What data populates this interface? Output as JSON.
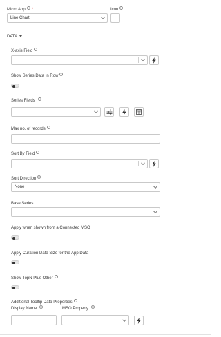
{
  "micro_app": {
    "label": "Micro App",
    "value": "Line Chart"
  },
  "icon": {
    "label": "Icon"
  },
  "data_section": {
    "label": "DATA"
  },
  "x_axis_field": {
    "label": "X-axis Field"
  },
  "show_series_data_in_row": {
    "label": "Show Series Data In Row"
  },
  "series_fields": {
    "label": "Series Fields"
  },
  "max_records": {
    "label": "Max no. of records",
    "value": ""
  },
  "sort_by_field": {
    "label": "Sort By Field"
  },
  "sort_direction": {
    "label": "Sort Direction",
    "value": "None"
  },
  "base_series": {
    "label": "Base Series"
  },
  "apply_connected_mso": {
    "label": "Apply when shown from a Connected MSO"
  },
  "apply_curation_data_size": {
    "label": "Apply Curation Data Size for the App Data"
  },
  "show_topn_plus_other": {
    "label": "Show TopN Plus Other"
  },
  "additional_tooltip": {
    "label": "Additional Tooltip Data Properties",
    "display_name_label": "Display Name",
    "mso_property_label": "MSO Property",
    "mso_property_suffix": "."
  }
}
